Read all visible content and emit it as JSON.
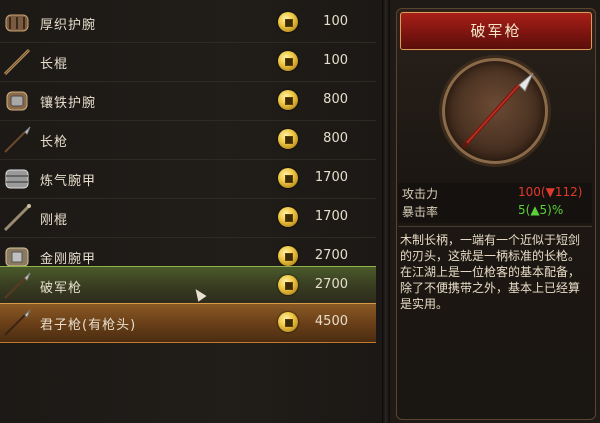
{
  "items": [
    {
      "name": "厚织护腕",
      "price": "100",
      "icon": "bracer-icon"
    },
    {
      "name": "长棍",
      "price": "100",
      "icon": "staff-icon"
    },
    {
      "name": "镶铁护腕",
      "price": "800",
      "icon": "iron-bracer-icon"
    },
    {
      "name": "长枪",
      "price": "800",
      "icon": "spear-icon"
    },
    {
      "name": "炼气腕甲",
      "price": "1700",
      "icon": "qi-bracer-icon"
    },
    {
      "name": "刚棍",
      "price": "1700",
      "icon": "steel-staff-icon"
    },
    {
      "name": "金刚腕甲",
      "price": "2700",
      "icon": "diamond-bracer-icon"
    },
    {
      "name": "破军枪",
      "price": "2700",
      "icon": "pojun-spear-icon"
    },
    {
      "name": "君子枪(有枪头)",
      "price": "4500",
      "icon": "junzi-spear-icon"
    }
  ],
  "detail": {
    "title": "破军枪",
    "attack_label": "攻击力",
    "attack_value": "100(▼112)",
    "crit_label": "暴击率",
    "crit_value": "5(▲5)%",
    "description": "木制长柄，一端有一个近似于短剑的刃头，这就是一柄标准的长枪。在江湖上是一位枪客的基本配备，除了不便携带之外，基本上已经算是实用。"
  },
  "colors": {
    "selected_row": "#3a3f22",
    "highlight_row": "#6b4018",
    "title_red": "#7a1410",
    "down": "#e23a2a",
    "up": "#5ad13a"
  }
}
